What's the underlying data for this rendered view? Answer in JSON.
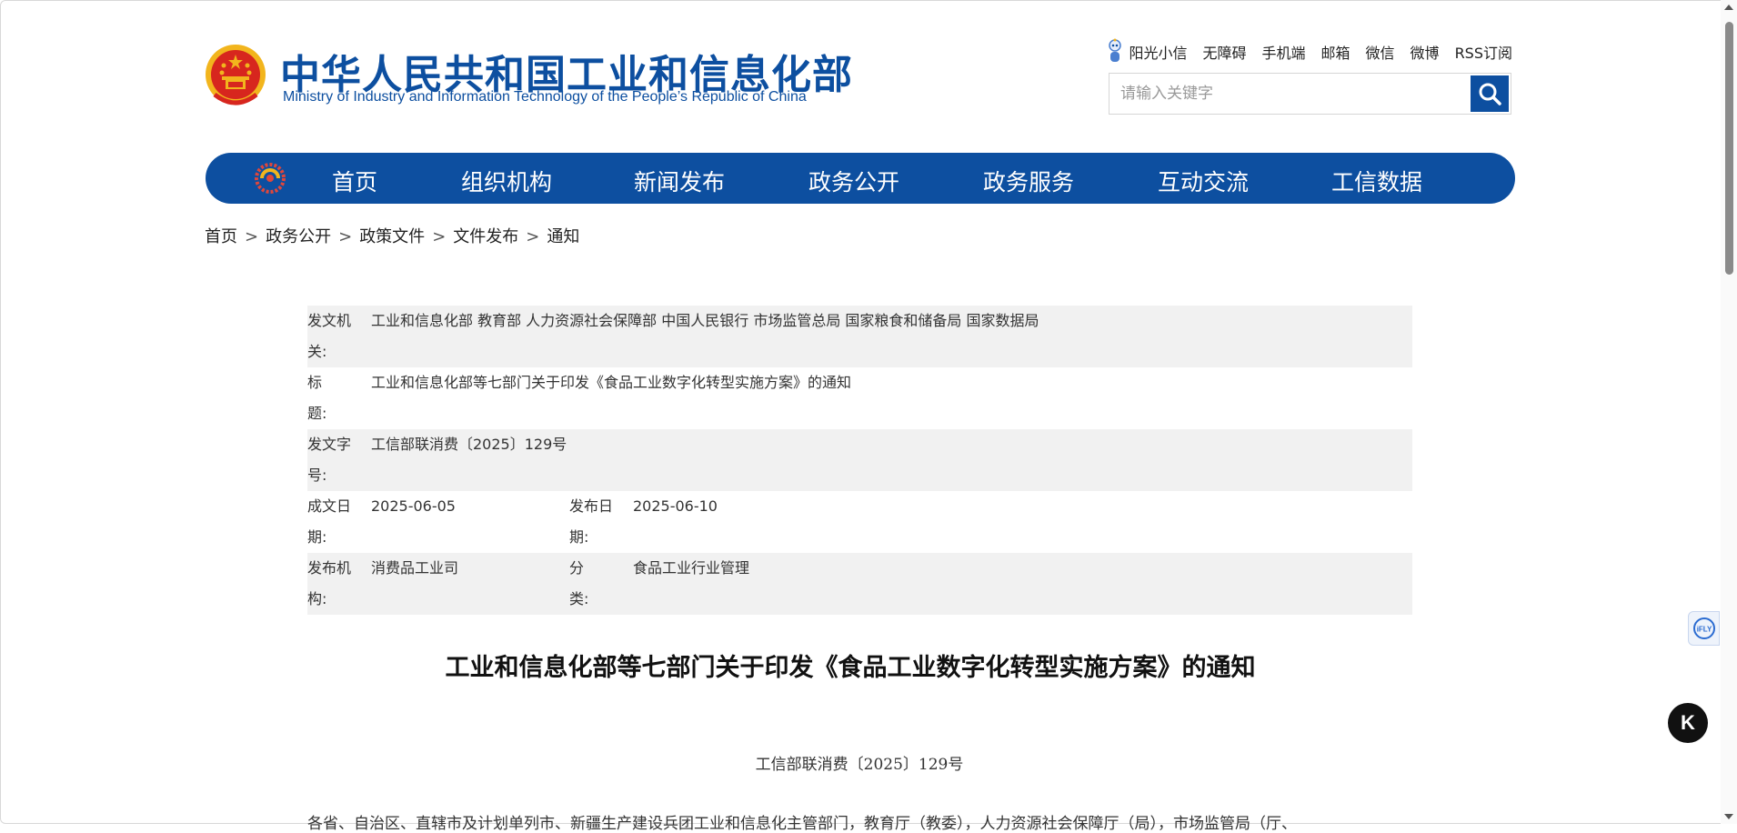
{
  "header": {
    "title": "中华人民共和国工业和信息化部",
    "subtitle": "Ministry of Industry and Information Technology of the People’s Republic of China",
    "top_links": [
      "阳光小信",
      "无障碍",
      "手机端",
      "邮箱",
      "微信",
      "微博",
      "RSS订阅"
    ],
    "search_placeholder": "请输入关键字"
  },
  "nav": {
    "items": [
      "首页",
      "组织机构",
      "新闻发布",
      "政务公开",
      "政务服务",
      "互动交流",
      "工信数据"
    ]
  },
  "breadcrumb": [
    "首页",
    "政务公开",
    "政策文件",
    "文件发布",
    "通知"
  ],
  "meta": {
    "issuer_label": "发文机关:",
    "issuer_value": "工业和信息化部 教育部 人力资源社会保障部 中国人民银行 市场监管总局 国家粮食和储备局 国家数据局",
    "title_label": "标题:",
    "title_value": "工业和信息化部等七部门关于印发《食品工业数字化转型实施方案》的通知",
    "docno_label": "发文字号:",
    "docno_value": "工信部联消费〔2025〕129号",
    "written_label": "成文日期:",
    "written_value": "2025-06-05",
    "published_label": "发布日期:",
    "published_value": "2025-06-10",
    "org_label": "发布机构:",
    "org_value": "消费品工业司",
    "category_label": "分类:",
    "category_value": "食品工业行业管理"
  },
  "document": {
    "title": "工业和信息化部等七部门关于印发《食品工业数字化转型实施方案》的通知",
    "number": "工信部联消费〔2025〕129号",
    "first_line": "各省、自治区、直辖市及计划单列市、新疆生产建设兵团工业和信息化主管部门，教育厅（教委），人力资源社会保障厅（局），市场监管局（厅、"
  },
  "widgets": {
    "iflytek_label": "iFLY",
    "k_label": "K"
  },
  "colors": {
    "brand_blue": "#0d4fa0",
    "emblem_red": "#d7261e",
    "emblem_gold": "#f2b51d"
  }
}
